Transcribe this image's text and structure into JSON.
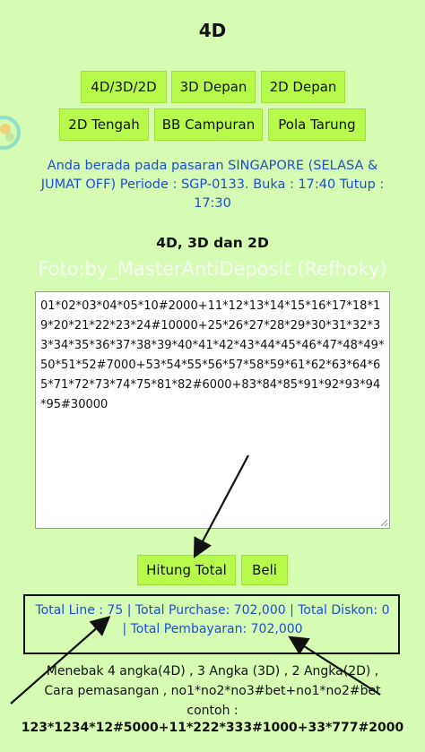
{
  "page_title": "4D",
  "menu": {
    "buttons": [
      "4D/3D/2D",
      "3D Depan",
      "2D Depan",
      "2D Tengah",
      "BB Campuran",
      "Pola Tarung"
    ]
  },
  "market_info": "Anda berada pada pasaran SINGAPORE (SELASA & JUMAT OFF) Periode : SGP-0133. Buka : 17:40 Tutup : 17:30",
  "section_title": "4D, 3D dan 2D",
  "watermark": "Foto:by_MasterAntiDeposit (Refhoky)",
  "bet_input": {
    "value": "01*02*03*04*05*10#2000+11*12*13*14*15*16*17*18*19*20*21*22*23*24#10000+25*26*27*28*29*30*31*32*33*34*35*36*37*38*39*40*41*42*43*44*45*46*47*48*49*50*51*52#7000+53*54*55*56*57*58*59*61*62*63*64*65*71*72*73*74*75*81*82#6000+83*84*85*91*92*93*94*95#30000"
  },
  "actions": {
    "calculate_label": "Hitung Total",
    "buy_label": "Beli"
  },
  "summary": {
    "line1": "Total Line : 75 | Total Purchase: 702,000 | Total Diskon: 0",
    "line2": "| Total Pembayaran: 702,000"
  },
  "help": {
    "line1": "Menebak 4 angka(4D) , 3 Angka (3D) , 2 Angka(2D) ,",
    "line2": "Cara pemasangan , no1*no2*no3#bet+no1*no2#bet",
    "line3": "contoh :"
  },
  "example": "123*1234*12#5000+11*222*333#1000+33*777#2000",
  "colors": {
    "background": "#d6fcb4",
    "button": "#b6fb4c",
    "info_text": "#1a4fd6"
  }
}
